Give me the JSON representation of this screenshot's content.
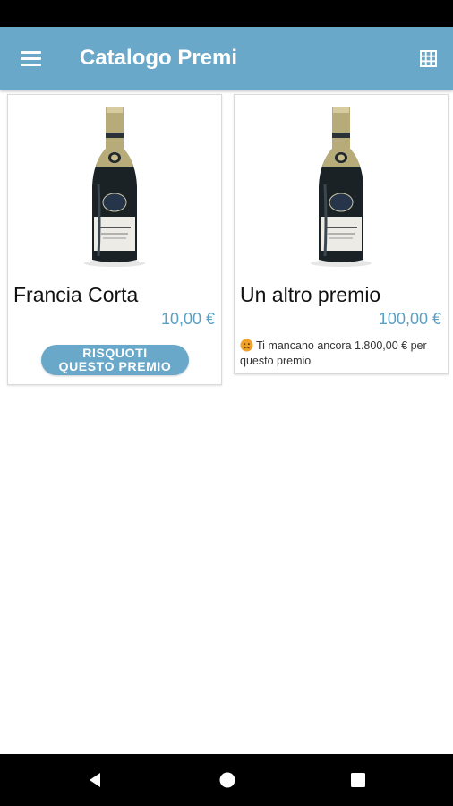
{
  "app_bar": {
    "title": "Catalogo Premi",
    "menu_icon": "menu-icon",
    "view_icon": "grid-view-icon"
  },
  "colors": {
    "primary": "#6aa8c9",
    "price": "#5a9fc4",
    "status_bar": "#000000",
    "nav_bar": "#000000"
  },
  "prizes": [
    {
      "name": "Francia Corta",
      "price": "10,00 €",
      "image_icon": "wine-bottle-image",
      "action_line1": "RISQUOTI",
      "action_line2": "QUESTO PREMIO"
    },
    {
      "name": "Un altro premio",
      "price": "100,00 €",
      "image_icon": "wine-bottle-image",
      "status_icon": "sad-face-icon",
      "missing_text": "Ti mancano ancora 1.800,00 € per questo premio"
    }
  ],
  "nav": {
    "back_icon": "back-triangle-icon",
    "home_icon": "home-circle-icon",
    "recents_icon": "recents-square-icon"
  }
}
